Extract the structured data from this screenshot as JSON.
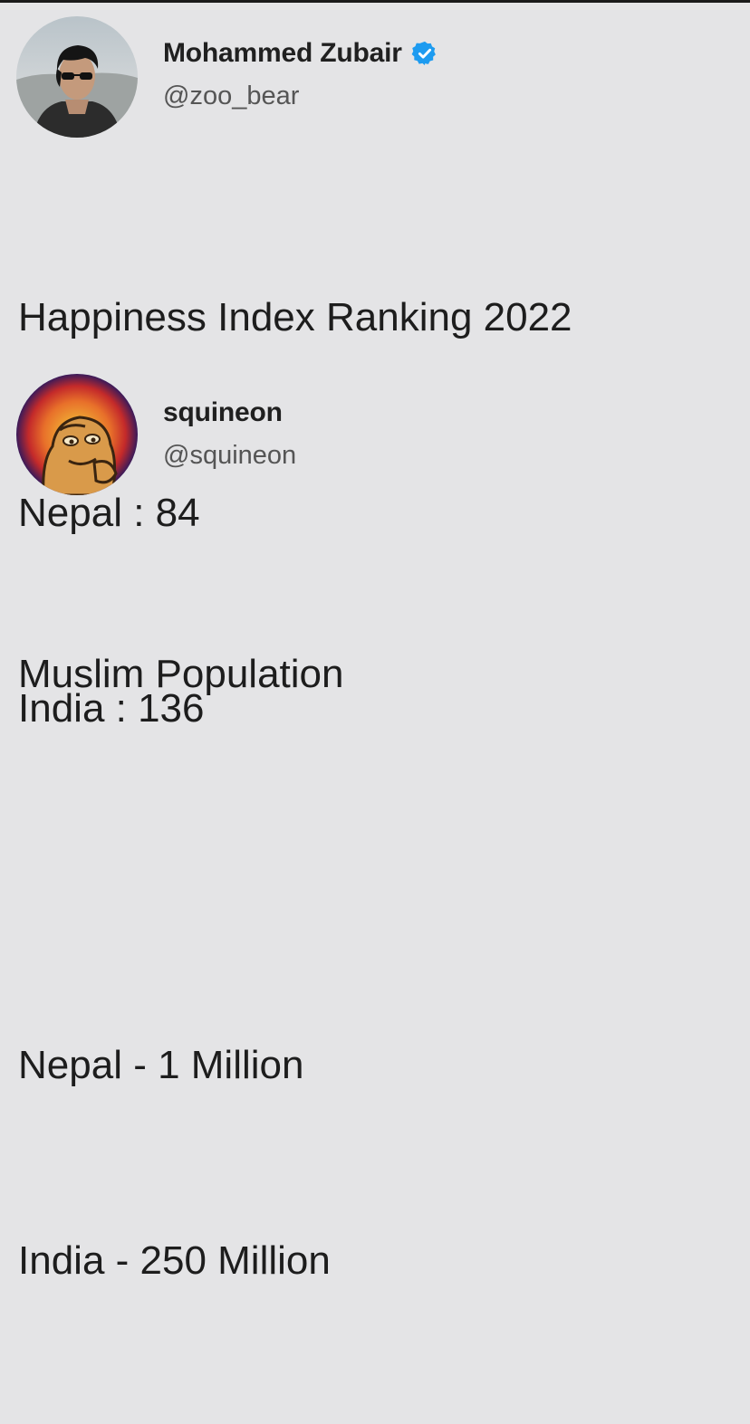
{
  "tweets": [
    {
      "author": {
        "name": "Mohammed Zubair",
        "handle": "@zoo_bear",
        "verified": true,
        "avatar_icon": "profile-photo-person-sunglasses"
      },
      "text_lines": [
        "Happiness Index Ranking 2022",
        "Nepal : 84",
        "India : 136"
      ]
    },
    {
      "author": {
        "name": "squineon",
        "handle": "@squineon",
        "verified": false,
        "avatar_icon": "cartoon-character-avatar"
      },
      "text_lines": [
        "Muslim Population",
        "",
        "Nepal - 1 Million",
        "India - 250 Million"
      ]
    }
  ],
  "colors": {
    "background": "#e4e4e6",
    "verified_badge": "#1d9bf0",
    "text": "#1d1d1d",
    "handle": "#555555"
  }
}
